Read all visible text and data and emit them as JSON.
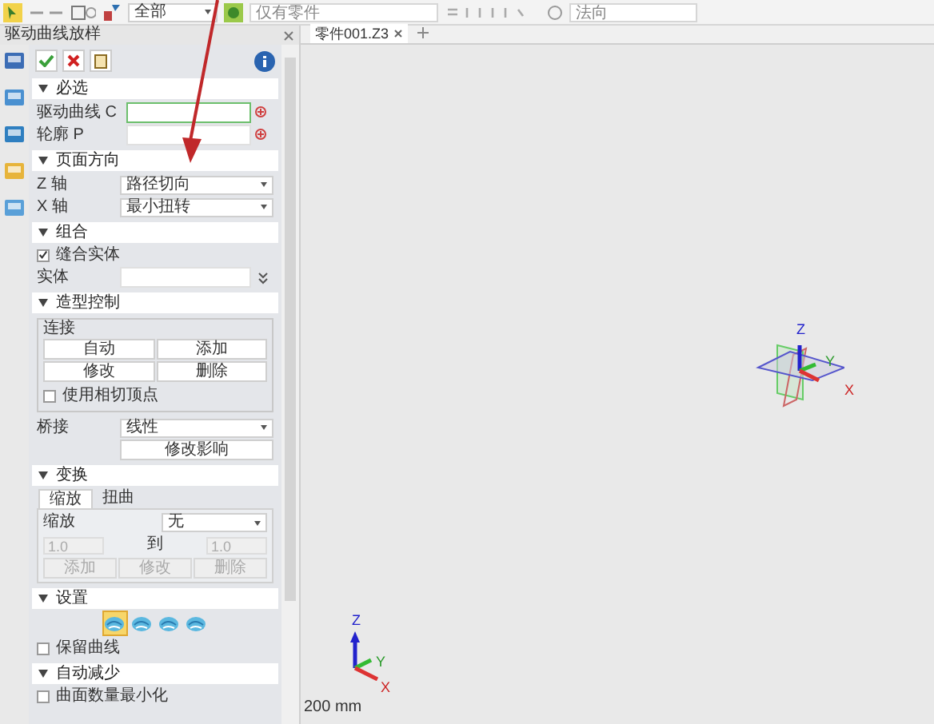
{
  "toolbar": {
    "filter": "全部",
    "part_filter": "仅有零件",
    "direction": "法向"
  },
  "panel": {
    "title": "驱动曲线放样"
  },
  "required": {
    "title": "必选",
    "fields": [
      {
        "label": "驱动曲线 C",
        "focused": true
      },
      {
        "label": "轮廓 P",
        "focused": false
      }
    ]
  },
  "orientation": {
    "title": "页面方向",
    "rows": [
      {
        "label": "Z 轴",
        "value": "路径切向"
      },
      {
        "label": "X 轴",
        "value": "最小扭转"
      }
    ]
  },
  "combine": {
    "title": "组合",
    "stitch": {
      "label": "缝合实体",
      "checked": true
    },
    "body_label": "实体"
  },
  "shape_control": {
    "title": "造型控制",
    "group": "连接",
    "buttons": [
      "自动",
      "添加",
      "修改",
      "删除"
    ],
    "tangent": {
      "label": "使用相切顶点",
      "checked": false
    },
    "bridge_label": "桥接",
    "bridge_value": "线性",
    "modify_button": "修改影响"
  },
  "transform": {
    "title": "变换",
    "tabs": [
      {
        "label": "缩放",
        "selected": true
      },
      {
        "label": "扭曲",
        "selected": false
      }
    ],
    "scale_label": "缩放",
    "scale_value": "无",
    "from": {
      "value": "1.0",
      "disabled": true
    },
    "to_label": "到",
    "to": {
      "value": "1.0",
      "disabled": true
    },
    "buttons": [
      {
        "label": "添加",
        "disabled": true
      },
      {
        "label": "修改",
        "disabled": true
      },
      {
        "label": "删除",
        "disabled": true
      }
    ]
  },
  "settings": {
    "title": "设置",
    "options": [
      {
        "selected": true
      },
      {
        "selected": false
      },
      {
        "selected": false
      },
      {
        "selected": false
      }
    ],
    "keep_curves": {
      "label": "保留曲线",
      "checked": false
    }
  },
  "auto_reduce": {
    "title": "自动减少",
    "minimize": {
      "label": "曲面数量最小化",
      "checked": false
    }
  },
  "viewport": {
    "tabs": [
      {
        "label": "零件001.Z3",
        "selected": true
      }
    ],
    "scale": "200 mm",
    "datum_axes": [
      "Z",
      "Y",
      "X"
    ],
    "triad_axes": [
      "Z",
      "Y",
      "X"
    ]
  }
}
